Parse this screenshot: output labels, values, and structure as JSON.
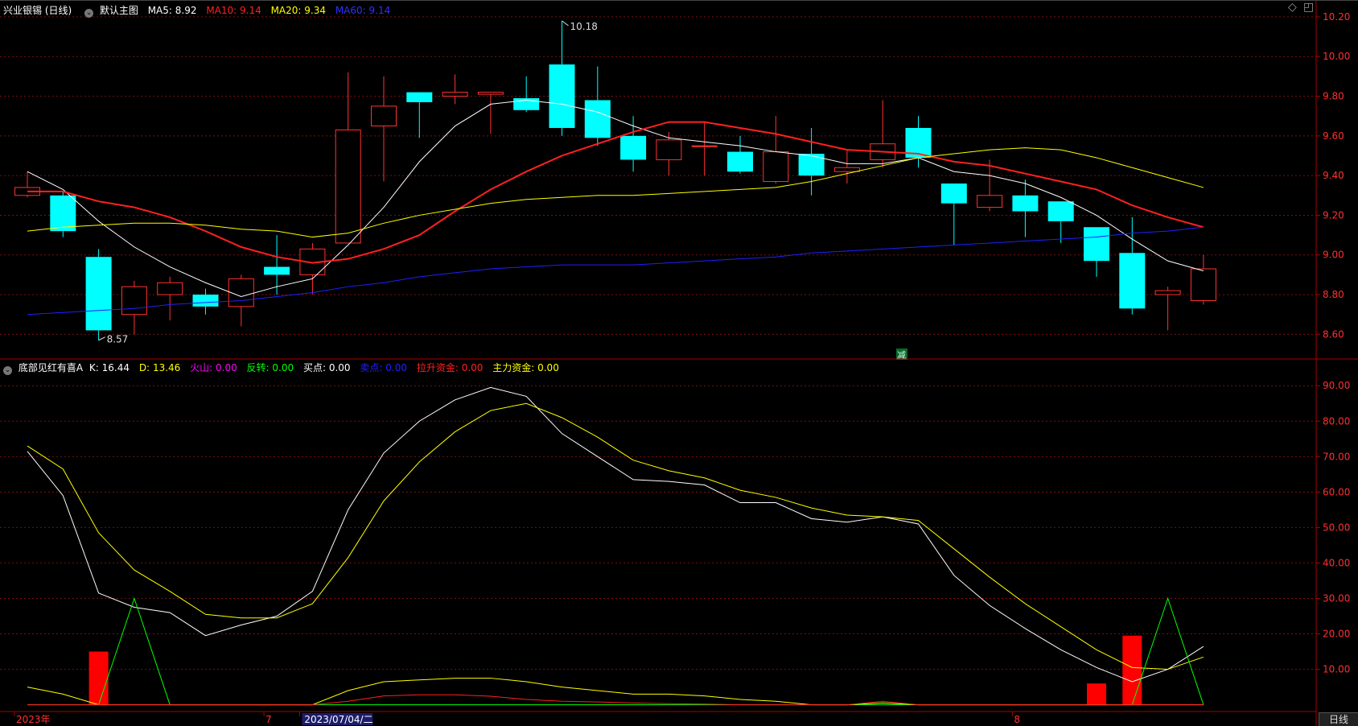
{
  "header": {
    "stock_name": "兴业银锡 (日线)",
    "main_chart_label": "默认主图",
    "ma5": {
      "label": "MA5:",
      "value": "8.92",
      "color": "#ffffff"
    },
    "ma10": {
      "label": "MA10:",
      "value": "9.14",
      "color": "#ff2020"
    },
    "ma20": {
      "label": "MA20:",
      "value": "9.34",
      "color": "#ffff00"
    },
    "ma60": {
      "label": "MA60:",
      "value": "9.14",
      "color": "#3030ff"
    }
  },
  "indicator_header": {
    "name": "底部见红有喜A",
    "k": {
      "label": "K:",
      "value": "16.44",
      "color": "#ffffff"
    },
    "d": {
      "label": "D:",
      "value": "13.46",
      "color": "#ffff00"
    },
    "volcano": {
      "label": "火山:",
      "value": "0.00",
      "color": "#ff00ff"
    },
    "reversal": {
      "label": "反转:",
      "value": "0.00",
      "color": "#00ff00"
    },
    "buy": {
      "label": "买点:",
      "value": "0.00",
      "color": "#ffffff"
    },
    "sell": {
      "label": "卖点:",
      "value": "0.00",
      "color": "#2020ff"
    },
    "pullup": {
      "label": "拉升资金:",
      "value": "0.00",
      "color": "#ff2020"
    },
    "main_fund": {
      "label": "主力资金:",
      "value": "0.00",
      "color": "#ffff00"
    }
  },
  "x_axis": {
    "labels": [
      {
        "text": "2023年",
        "index": 0
      },
      {
        "text": "7",
        "index": 7
      },
      {
        "text": "2023/07/04/二",
        "index": 8,
        "highlight": true
      },
      {
        "text": "8",
        "index": 28
      }
    ]
  },
  "period_button": "日线",
  "reduce_marker": "减",
  "colors": {
    "up": "#ff3232",
    "down": "#00ffff",
    "grid": "#7a1010",
    "axis": "#aa0000",
    "tick_text": "#ff3030"
  },
  "chart_data": [
    {
      "type": "candlestick",
      "title": "兴业银锡 (日线)",
      "ylim": [
        8.5,
        10.22
      ],
      "y_ticks": [
        8.6,
        8.8,
        9.0,
        9.2,
        9.4,
        9.6,
        9.8,
        10.0,
        10.2
      ],
      "high_annotation": {
        "text": "10.18",
        "index": 15,
        "value": 10.18
      },
      "low_annotation": {
        "text": "8.57",
        "index": 2,
        "value": 8.57
      },
      "candles": [
        {
          "o": 9.3,
          "h": 9.42,
          "l": 9.29,
          "c": 9.34
        },
        {
          "o": 9.3,
          "h": 9.32,
          "l": 9.09,
          "c": 9.12
        },
        {
          "o": 8.99,
          "h": 9.03,
          "l": 8.57,
          "c": 8.62
        },
        {
          "o": 8.7,
          "h": 8.87,
          "l": 8.6,
          "c": 8.84
        },
        {
          "o": 8.8,
          "h": 8.89,
          "l": 8.67,
          "c": 8.86
        },
        {
          "o": 8.8,
          "h": 8.83,
          "l": 8.7,
          "c": 8.74
        },
        {
          "o": 8.74,
          "h": 8.9,
          "l": 8.64,
          "c": 8.88
        },
        {
          "o": 8.94,
          "h": 9.1,
          "l": 8.8,
          "c": 8.9
        },
        {
          "o": 8.9,
          "h": 9.06,
          "l": 8.8,
          "c": 9.03
        },
        {
          "o": 9.06,
          "h": 9.92,
          "l": 9.06,
          "c": 9.63
        },
        {
          "o": 9.65,
          "h": 9.9,
          "l": 9.37,
          "c": 9.75
        },
        {
          "o": 9.82,
          "h": 9.82,
          "l": 9.59,
          "c": 9.77
        },
        {
          "o": 9.8,
          "h": 9.91,
          "l": 9.76,
          "c": 9.82
        },
        {
          "o": 9.81,
          "h": 9.82,
          "l": 9.61,
          "c": 9.82
        },
        {
          "o": 9.79,
          "h": 9.9,
          "l": 9.72,
          "c": 9.73
        },
        {
          "o": 9.96,
          "h": 10.18,
          "l": 9.6,
          "c": 9.64
        },
        {
          "o": 9.78,
          "h": 9.95,
          "l": 9.55,
          "c": 9.59
        },
        {
          "o": 9.6,
          "h": 9.7,
          "l": 9.42,
          "c": 9.48
        },
        {
          "o": 9.48,
          "h": 9.62,
          "l": 9.4,
          "c": 9.58
        },
        {
          "o": 9.55,
          "h": 9.67,
          "l": 9.4,
          "c": 9.55
        },
        {
          "o": 9.52,
          "h": 9.6,
          "l": 9.41,
          "c": 9.42
        },
        {
          "o": 9.37,
          "h": 9.7,
          "l": 9.36,
          "c": 9.52
        },
        {
          "o": 9.51,
          "h": 9.64,
          "l": 9.3,
          "c": 9.4
        },
        {
          "o": 9.42,
          "h": 9.53,
          "l": 9.36,
          "c": 9.44
        },
        {
          "o": 9.48,
          "h": 9.78,
          "l": 9.44,
          "c": 9.56
        },
        {
          "o": 9.64,
          "h": 9.7,
          "l": 9.44,
          "c": 9.49
        },
        {
          "o": 9.36,
          "h": 9.36,
          "l": 9.05,
          "c": 9.26
        },
        {
          "o": 9.24,
          "h": 9.48,
          "l": 9.22,
          "c": 9.3
        },
        {
          "o": 9.3,
          "h": 9.38,
          "l": 9.09,
          "c": 9.22
        },
        {
          "o": 9.27,
          "h": 9.27,
          "l": 9.06,
          "c": 9.17
        },
        {
          "o": 9.14,
          "h": 9.14,
          "l": 8.89,
          "c": 8.97
        },
        {
          "o": 9.01,
          "h": 9.19,
          "l": 8.7,
          "c": 8.73
        },
        {
          "o": 8.8,
          "h": 8.84,
          "l": 8.62,
          "c": 8.82
        },
        {
          "o": 8.77,
          "h": 9.0,
          "l": 8.75,
          "c": 8.93
        }
      ],
      "series": [
        {
          "name": "MA5",
          "color": "#ffffff",
          "values": [
            9.42,
            9.33,
            9.17,
            9.04,
            8.94,
            8.86,
            8.79,
            8.84,
            8.88,
            9.05,
            9.24,
            9.47,
            9.65,
            9.76,
            9.78,
            9.76,
            9.72,
            9.65,
            9.59,
            9.57,
            9.55,
            9.52,
            9.5,
            9.46,
            9.46,
            9.49,
            9.42,
            9.4,
            9.36,
            9.29,
            9.2,
            9.08,
            8.97,
            8.92
          ]
        },
        {
          "name": "MA10",
          "color": "#ff2020",
          "values": [
            9.32,
            9.32,
            9.27,
            9.24,
            9.19,
            9.12,
            9.04,
            8.99,
            8.96,
            8.98,
            9.03,
            9.1,
            9.22,
            9.33,
            9.42,
            9.5,
            9.56,
            9.62,
            9.67,
            9.67,
            9.64,
            9.61,
            9.57,
            9.53,
            9.52,
            9.51,
            9.47,
            9.45,
            9.41,
            9.37,
            9.33,
            9.25,
            9.19,
            9.14
          ]
        },
        {
          "name": "MA20",
          "color": "#ffff00",
          "values": [
            9.12,
            9.14,
            9.15,
            9.16,
            9.16,
            9.15,
            9.13,
            9.12,
            9.09,
            9.11,
            9.16,
            9.2,
            9.23,
            9.26,
            9.28,
            9.29,
            9.3,
            9.3,
            9.31,
            9.32,
            9.33,
            9.34,
            9.37,
            9.41,
            9.45,
            9.49,
            9.51,
            9.53,
            9.54,
            9.53,
            9.49,
            9.44,
            9.39,
            9.34
          ]
        },
        {
          "name": "MA60",
          "color": "#2020ff",
          "values": [
            8.7,
            8.71,
            8.72,
            8.73,
            8.75,
            8.76,
            8.77,
            8.79,
            8.81,
            8.84,
            8.86,
            8.89,
            8.91,
            8.93,
            8.94,
            8.95,
            8.95,
            8.95,
            8.96,
            8.97,
            8.98,
            8.99,
            9.01,
            9.02,
            9.03,
            9.04,
            9.05,
            9.06,
            9.07,
            9.08,
            9.09,
            9.11,
            9.12,
            9.14
          ]
        }
      ]
    },
    {
      "type": "line",
      "title": "底部见红有喜A",
      "ylim": [
        -1,
        93
      ],
      "y_ticks": [
        10,
        20,
        30,
        40,
        50,
        60,
        70,
        80,
        90
      ],
      "series": [
        {
          "name": "K",
          "color": "#ffffff",
          "values": [
            71.5,
            59,
            31.5,
            27.5,
            26,
            19.5,
            22.5,
            25,
            32,
            55,
            71,
            80,
            86,
            89.5,
            87,
            76.5,
            70,
            63.5,
            63,
            62,
            57,
            57,
            52.5,
            51.5,
            53,
            51,
            36.5,
            28,
            21.5,
            15.5,
            10.5,
            6.5,
            10,
            16.44
          ]
        },
        {
          "name": "D",
          "color": "#ffff00",
          "values": [
            73,
            66.5,
            48.5,
            38,
            32,
            25.5,
            24.5,
            24.5,
            28.5,
            41.5,
            57.5,
            68.5,
            77,
            83,
            85,
            81,
            75.5,
            69,
            66,
            64,
            60.5,
            58.5,
            55.5,
            53.5,
            53,
            52,
            44,
            36,
            28.5,
            22,
            15.5,
            10.5,
            10,
            13.46
          ]
        },
        {
          "name": "反转",
          "color": "#00ff00",
          "values": [
            0,
            0,
            0,
            30,
            0,
            0,
            0,
            0,
            0,
            0,
            0,
            0,
            0,
            0,
            0,
            0,
            0,
            0,
            0,
            0,
            0,
            0,
            0,
            0,
            0,
            0,
            0,
            0,
            0,
            0,
            0,
            0,
            30,
            0
          ]
        },
        {
          "name": "主力资金",
          "color": "#ffff00",
          "values": [
            5,
            3,
            0,
            0,
            0,
            0,
            0,
            0,
            0,
            4,
            6.5,
            7,
            7.5,
            7.5,
            6.5,
            5,
            4,
            3,
            3,
            2.5,
            1.5,
            1,
            0,
            0,
            0.5,
            0,
            0,
            0,
            0,
            0,
            0,
            0,
            0,
            0
          ]
        },
        {
          "name": "拉升资金",
          "color": "#ff2020",
          "values": [
            0,
            0,
            0,
            0,
            0,
            0,
            0,
            0,
            0,
            1,
            2.5,
            2.8,
            2.8,
            2.4,
            1.5,
            1,
            0.8,
            0.5,
            0.3,
            0.2,
            0,
            0,
            0,
            0,
            1,
            0,
            0,
            0,
            0,
            0,
            0,
            0,
            0,
            0
          ]
        }
      ],
      "bars": {
        "name": "底部见红",
        "color": "#ff0000",
        "values": [
          0,
          0,
          15,
          0,
          0,
          0,
          0,
          0,
          0,
          0,
          0,
          0,
          0,
          0,
          0,
          0,
          0,
          0,
          0,
          0,
          0,
          0,
          0,
          0,
          0,
          0,
          0,
          0,
          0,
          0,
          6,
          19.5,
          0,
          0
        ]
      }
    }
  ]
}
